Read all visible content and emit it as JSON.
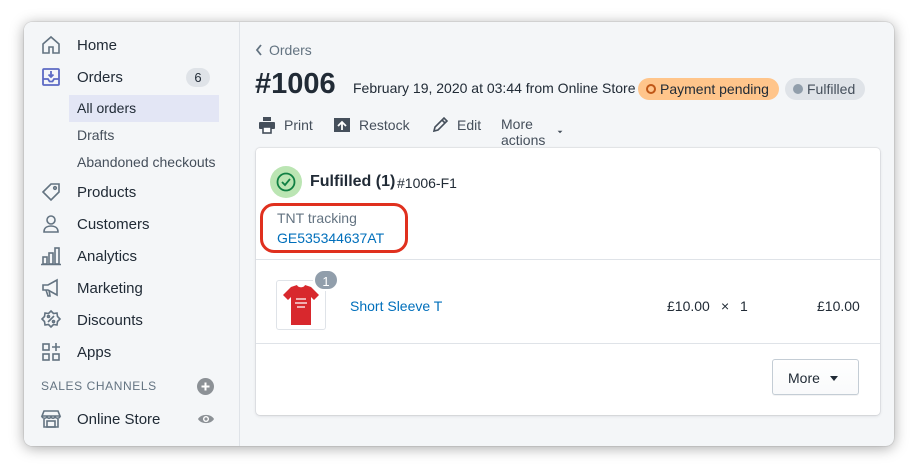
{
  "sidebar": {
    "items": [
      {
        "label": "Home",
        "icon": "home-icon"
      },
      {
        "label": "Orders",
        "icon": "orders-icon",
        "badge": "6"
      },
      {
        "label": "Products",
        "icon": "tag-icon"
      },
      {
        "label": "Customers",
        "icon": "person-icon"
      },
      {
        "label": "Analytics",
        "icon": "bar-chart-icon"
      },
      {
        "label": "Marketing",
        "icon": "megaphone-icon"
      },
      {
        "label": "Discounts",
        "icon": "discount-icon"
      },
      {
        "label": "Apps",
        "icon": "apps-icon"
      }
    ],
    "orders_sub": [
      "All orders",
      "Drafts",
      "Abandoned checkouts"
    ],
    "sales_channels_title": "SALES CHANNELS",
    "online_store": "Online Store"
  },
  "breadcrumb": "Orders",
  "order": {
    "number": "#1006",
    "meta": "February 19, 2020 at 03:44 from Online Store",
    "payment_status": "Payment pending",
    "fulfillment_status": "Fulfilled"
  },
  "actions": {
    "print": "Print",
    "restock": "Restock",
    "edit": "Edit",
    "more_actions": "More actions"
  },
  "fulfillment": {
    "title": "Fulfilled (1)",
    "id": "#1006-F1",
    "tracking_label": "TNT tracking",
    "tracking_number": "GE535344637AT"
  },
  "line_item": {
    "quantity_badge": "1",
    "name": "Short Sleeve T",
    "price": "£10.00",
    "times": "×",
    "quantity": "1",
    "total": "£10.00"
  },
  "more_button": "More",
  "colors": {
    "link": "#006fbb",
    "pending_badge": "#ffc58b",
    "fulfilled_badge": "#dfe3e8",
    "highlight": "#e0301e",
    "success": "#bbe5b3"
  }
}
